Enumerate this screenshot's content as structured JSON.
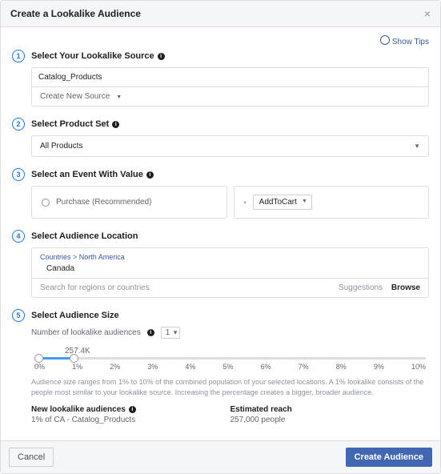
{
  "header": {
    "title": "Create a Lookalike Audience"
  },
  "tips_label": "Show Tips",
  "steps": {
    "source": {
      "num": "1",
      "title": "Select Your Lookalike Source",
      "value": "Catalog_Products",
      "create_new": "Create New Source"
    },
    "product": {
      "num": "2",
      "title": "Select Product Set",
      "value": "All Products"
    },
    "event": {
      "num": "3",
      "title": "Select an Event With Value",
      "recommended": "Purchase (Recommended)",
      "selected": "AddToCart"
    },
    "location": {
      "num": "4",
      "title": "Select Audience Location",
      "breadcrumb": "Countries > North America",
      "value": "Canada",
      "placeholder": "Search for regions or countries",
      "suggestions": "Suggestions",
      "browse": "Browse"
    },
    "size": {
      "num": "5",
      "title": "Select Audience Size",
      "count_label": "Number of lookalike audiences",
      "count": "1",
      "slider_value": "257.4K",
      "ticks": [
        "0%",
        "1%",
        "2%",
        "3%",
        "4%",
        "5%",
        "6%",
        "7%",
        "8%",
        "9%",
        "10%"
      ],
      "desc": "Audience size ranges from 1% to 10% of the combined population of your selected locations. A 1% lookalike consists of the people most similar to your lookalike source. Increasing the percentage creates a bigger, broader audience.",
      "new_label": "New lookalike audiences",
      "new_value": "1% of CA - Catalog_Products",
      "reach_label": "Estimated reach",
      "reach_value": "257,000 people"
    }
  },
  "footer": {
    "cancel": "Cancel",
    "create": "Create Audience"
  }
}
